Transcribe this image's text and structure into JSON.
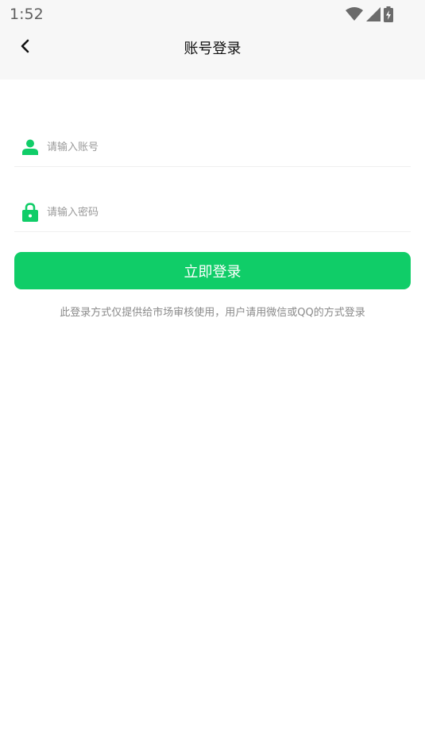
{
  "status_bar": {
    "time": "1:52",
    "icons": [
      "wifi-icon",
      "cellular-signal-icon",
      "battery-charging-icon"
    ]
  },
  "header": {
    "title": "账号登录",
    "back_icon": "chevron-left-icon"
  },
  "form": {
    "account": {
      "icon": "user-icon",
      "placeholder": "请输入账号",
      "value": ""
    },
    "password": {
      "icon": "lock-icon",
      "placeholder": "请输入密码",
      "value": ""
    },
    "submit_label": "立即登录",
    "note": "此登录方式仅提供给市场审核使用，用户请用微信或QQ的方式登录"
  },
  "colors": {
    "accent": "#10cd68",
    "header_bg": "#f7f7f7",
    "note_text": "#8a8a8a",
    "placeholder_text": "#9a9a9a"
  }
}
